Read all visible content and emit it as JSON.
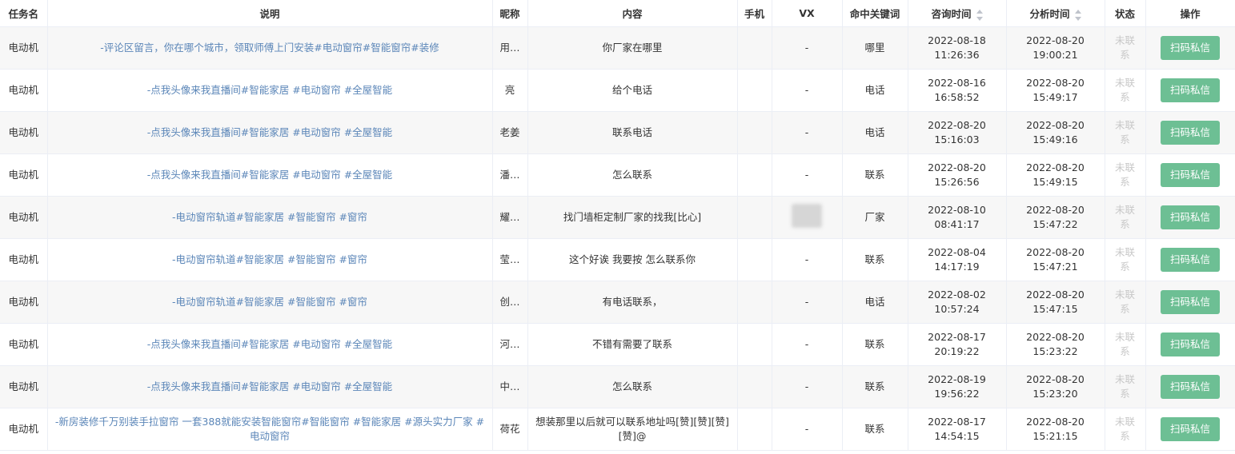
{
  "headers": {
    "task": "任务名",
    "desc": "说明",
    "nick": "昵称",
    "content": "内容",
    "phone": "手机",
    "vx": "VX",
    "keyword": "命中关键词",
    "consult_time": "咨询时间",
    "analysis_time": "分析时间",
    "status": "状态",
    "action": "操作"
  },
  "rows": [
    {
      "task": "电动机",
      "desc": "-评论区留言，你在哪个城市，领取师傅上门安装#电动窗帘#智能窗帘#装修",
      "nick": "用…",
      "content": "你厂家在哪里",
      "phone": "",
      "vx": "-",
      "keyword": "哪里",
      "consult_date": "2022-08-18",
      "consult_clock": "11:26:36",
      "analysis_date": "2022-08-20",
      "analysis_clock": "19:00:21",
      "status": "未联系",
      "action": "扫码私信"
    },
    {
      "task": "电动机",
      "desc": "-点我头像来我直播间#智能家居 #电动窗帘 #全屋智能",
      "nick": "亮",
      "content": "给个电话",
      "phone": "",
      "vx": "-",
      "keyword": "电话",
      "consult_date": "2022-08-16",
      "consult_clock": "16:58:52",
      "analysis_date": "2022-08-20",
      "analysis_clock": "15:49:17",
      "status": "未联系",
      "action": "扫码私信"
    },
    {
      "task": "电动机",
      "desc": "-点我头像来我直播间#智能家居 #电动窗帘 #全屋智能",
      "nick": "老姜",
      "content": "联系电话",
      "phone": "",
      "vx": "-",
      "keyword": "电话",
      "consult_date": "2022-08-20",
      "consult_clock": "15:16:03",
      "analysis_date": "2022-08-20",
      "analysis_clock": "15:49:16",
      "status": "未联系",
      "action": "扫码私信"
    },
    {
      "task": "电动机",
      "desc": "-点我头像来我直播间#智能家居 #电动窗帘 #全屋智能",
      "nick": "潘…",
      "content": "怎么联系",
      "phone": "",
      "vx": "-",
      "keyword": "联系",
      "consult_date": "2022-08-20",
      "consult_clock": "15:26:56",
      "analysis_date": "2022-08-20",
      "analysis_clock": "15:49:15",
      "status": "未联系",
      "action": "扫码私信"
    },
    {
      "task": "电动机",
      "desc": "-电动窗帘轨道#智能家居 #智能窗帘 #窗帘",
      "nick": "耀…",
      "content": "找门墙柜定制厂家的找我[比心]",
      "phone": "",
      "vx": "",
      "keyword": "厂家",
      "consult_date": "2022-08-10",
      "consult_clock": "08:41:17",
      "analysis_date": "2022-08-20",
      "analysis_clock": "15:47:22",
      "status": "未联系",
      "action": "扫码私信"
    },
    {
      "task": "电动机",
      "desc": "-电动窗帘轨道#智能家居 #智能窗帘 #窗帘",
      "nick": "莹…",
      "content": "这个好诶 我要按 怎么联系你",
      "phone": "",
      "vx": "-",
      "keyword": "联系",
      "consult_date": "2022-08-04",
      "consult_clock": "14:17:19",
      "analysis_date": "2022-08-20",
      "analysis_clock": "15:47:21",
      "status": "未联系",
      "action": "扫码私信"
    },
    {
      "task": "电动机",
      "desc": "-电动窗帘轨道#智能家居 #智能窗帘 #窗帘",
      "nick": "创…",
      "content": "有电话联系，",
      "phone": "",
      "vx": "-",
      "keyword": "电话",
      "consult_date": "2022-08-02",
      "consult_clock": "10:57:24",
      "analysis_date": "2022-08-20",
      "analysis_clock": "15:47:15",
      "status": "未联系",
      "action": "扫码私信"
    },
    {
      "task": "电动机",
      "desc": "-点我头像来我直播间#智能家居 #电动窗帘 #全屋智能",
      "nick": "河…",
      "content": "不错有需要了联系",
      "phone": "",
      "vx": "-",
      "keyword": "联系",
      "consult_date": "2022-08-17",
      "consult_clock": "20:19:22",
      "analysis_date": "2022-08-20",
      "analysis_clock": "15:23:22",
      "status": "未联系",
      "action": "扫码私信"
    },
    {
      "task": "电动机",
      "desc": "-点我头像来我直播间#智能家居 #电动窗帘 #全屋智能",
      "nick": "中…",
      "content": "怎么联系",
      "phone": "",
      "vx": "-",
      "keyword": "联系",
      "consult_date": "2022-08-19",
      "consult_clock": "19:56:22",
      "analysis_date": "2022-08-20",
      "analysis_clock": "15:23:20",
      "status": "未联系",
      "action": "扫码私信"
    },
    {
      "task": "电动机",
      "desc": "-新房装修千万别装手拉窗帘 一套388就能安装智能窗帘#智能窗帘 #智能家居 #源头实力厂家 #电动窗帘",
      "nick": "荷花",
      "content": "想装那里以后就可以联系地址吗[赞][赞][赞][赞]@",
      "phone": "",
      "vx": "-",
      "keyword": "联系",
      "consult_date": "2022-08-17",
      "consult_clock": "14:54:15",
      "analysis_date": "2022-08-20",
      "analysis_clock": "15:21:15",
      "status": "未联系",
      "action": "扫码私信"
    }
  ]
}
